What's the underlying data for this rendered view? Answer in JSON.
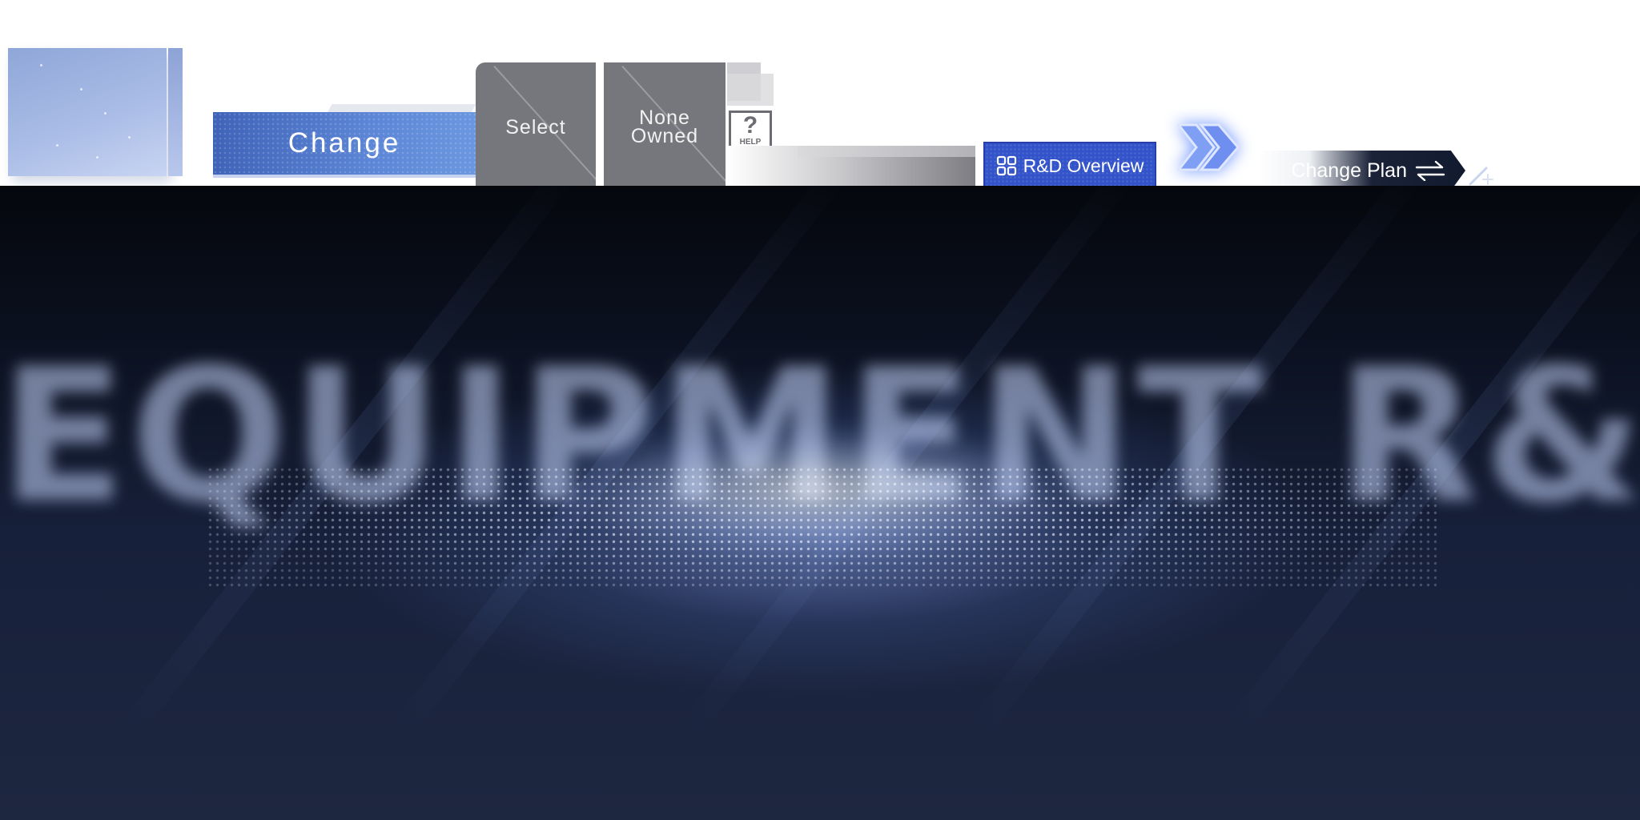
{
  "buttons": {
    "change_label": "Change",
    "select_label": "Select",
    "none_owned_label": "None\nOwned",
    "help_symbol": "?",
    "help_label": "HELP",
    "rd_overview_label": "R&D Overview",
    "change_plan_label": "Change Plan"
  },
  "scene": {
    "banner_text": "EQUIPMENT R&D"
  },
  "icons": {
    "rd_overview": "grid-icon",
    "change_plan": "swap-arrows-icon",
    "advance": "double-chevron-icon",
    "help": "help-icon"
  },
  "colors": {
    "accent_blue": "#3253c9",
    "change_button": "#4f76cc",
    "tab_gray": "#76777c",
    "arrow_glow": "#6f95ff"
  }
}
